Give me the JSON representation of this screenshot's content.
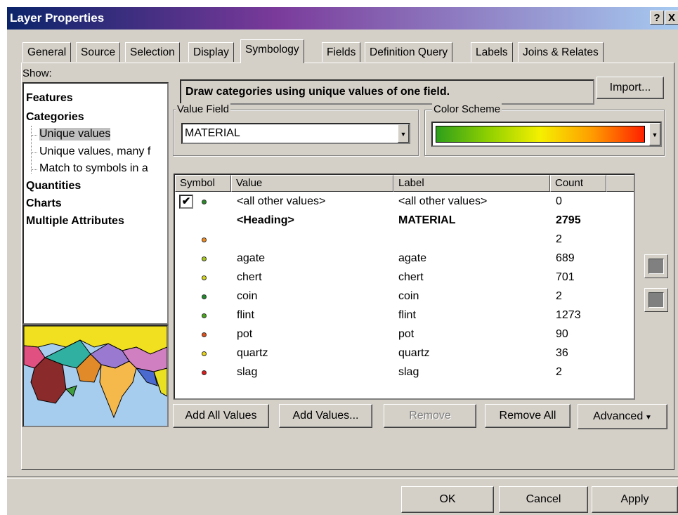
{
  "window": {
    "title": "Layer Properties",
    "help_label": "?",
    "close_label": "X"
  },
  "tabs": [
    {
      "label": "General"
    },
    {
      "label": "Source"
    },
    {
      "label": "Selection"
    },
    {
      "label": "Display"
    },
    {
      "label": "Symbology"
    },
    {
      "label": "Fields"
    },
    {
      "label": "Definition Query"
    },
    {
      "label": "Labels"
    },
    {
      "label": "Joins & Relates"
    }
  ],
  "active_tab": "Symbology",
  "show": {
    "label": "Show:",
    "items": [
      {
        "label": "Features"
      },
      {
        "label": "Categories"
      },
      {
        "label": "Unique values"
      },
      {
        "label": "Unique values, many f"
      },
      {
        "label": "Match to symbols in a"
      },
      {
        "label": "Quantities"
      },
      {
        "label": "Charts"
      },
      {
        "label": "Multiple Attributes"
      }
    ],
    "selected": "Unique values"
  },
  "description": "Draw categories using unique values of one field.",
  "import_label": "Import...",
  "value_field": {
    "legend": "Value Field",
    "value": "MATERIAL"
  },
  "color_scheme": {
    "legend": "Color Scheme",
    "colors": [
      "#2e9f1a",
      "#8fd000",
      "#f5f000",
      "#ff9c00",
      "#ff2000"
    ]
  },
  "table": {
    "headers": [
      "Symbol",
      "Value",
      "Label",
      "Count"
    ],
    "rows": [
      {
        "checked": true,
        "color": "#2a8a2a",
        "value": "<all other values>",
        "label": "<all other values>",
        "count": "0",
        "bold": false
      },
      {
        "checked": false,
        "color": "",
        "value": "<Heading>",
        "label": "MATERIAL",
        "count": "2795",
        "bold": true
      },
      {
        "checked": false,
        "color": "#f08a1e",
        "value": "",
        "label": "",
        "count": "2",
        "bold": false
      },
      {
        "checked": false,
        "color": "#a6c81a",
        "value": "agate",
        "label": "agate",
        "count": "689",
        "bold": false
      },
      {
        "checked": false,
        "color": "#d6d61a",
        "value": "chert",
        "label": "chert",
        "count": "701",
        "bold": false
      },
      {
        "checked": false,
        "color": "#1e8a2a",
        "value": "coin",
        "label": "coin",
        "count": "2",
        "bold": false
      },
      {
        "checked": false,
        "color": "#4aa81a",
        "value": "flint",
        "label": "flint",
        "count": "1273",
        "bold": false
      },
      {
        "checked": false,
        "color": "#e0501a",
        "value": "pot",
        "label": "pot",
        "count": "90",
        "bold": false
      },
      {
        "checked": false,
        "color": "#e8d41a",
        "value": "quartz",
        "label": "quartz",
        "count": "36",
        "bold": false
      },
      {
        "checked": false,
        "color": "#e01a1a",
        "value": "slag",
        "label": "slag",
        "count": "2",
        "bold": false
      }
    ]
  },
  "buttons": {
    "add_all": "Add All Values",
    "add_values": "Add Values...",
    "remove": "Remove",
    "remove_all": "Remove All",
    "advanced": "Advanced",
    "ok": "OK",
    "cancel": "Cancel",
    "apply": "Apply"
  }
}
